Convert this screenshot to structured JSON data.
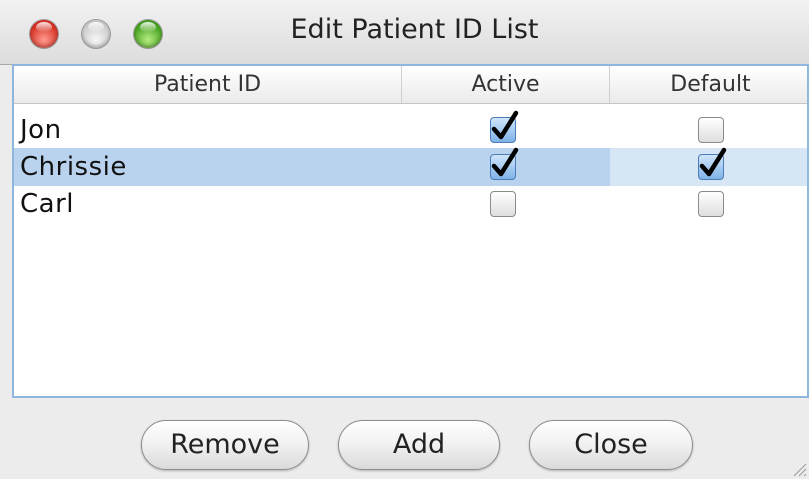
{
  "window": {
    "title": "Edit Patient ID List"
  },
  "table": {
    "headers": [
      "Patient ID",
      "Active",
      "Default"
    ],
    "rows": [
      {
        "patient_id": "Jon",
        "active": true,
        "default": false,
        "selected": false
      },
      {
        "patient_id": "Chrissie",
        "active": true,
        "default": true,
        "selected": true
      },
      {
        "patient_id": "Carl",
        "active": false,
        "default": false,
        "selected": false
      }
    ]
  },
  "buttons": {
    "remove": "Remove",
    "add": "Add",
    "close": "Close"
  }
}
